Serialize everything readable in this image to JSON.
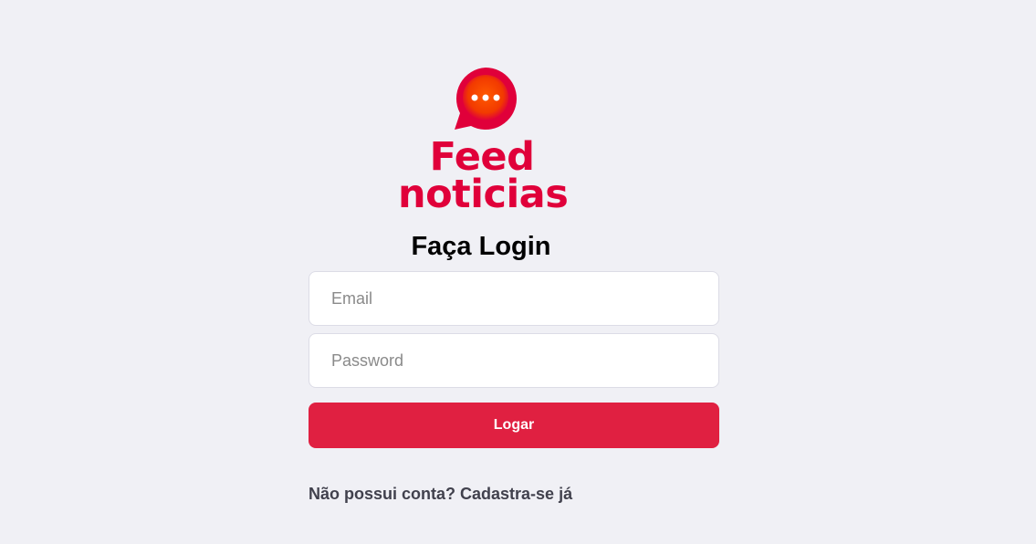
{
  "brand": {
    "line1": "Feed",
    "line2": "noticias",
    "color": "#e0003a",
    "icon": "chat-bubble-icon"
  },
  "login": {
    "title": "Faça Login",
    "email_placeholder": "Email",
    "password_placeholder": "Password",
    "button_label": "Logar",
    "button_color": "#e02041",
    "register_link": "Não possui conta? Cadastra-se já"
  },
  "colors": {
    "background": "#f0f0f5",
    "text": "#41414d"
  }
}
